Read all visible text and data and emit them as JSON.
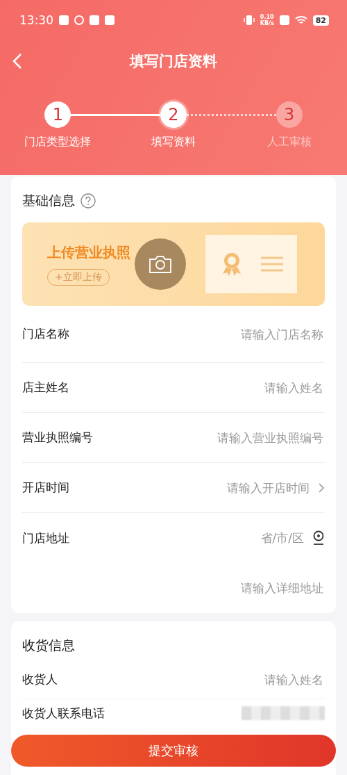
{
  "status_bar": {
    "time": "13:30",
    "speed_value": "0.10",
    "speed_unit": "KB/s",
    "battery": "82"
  },
  "header": {
    "title": "填写门店资料"
  },
  "steps": [
    {
      "number": "1",
      "label": "门店类型选择",
      "done": true,
      "selected": false
    },
    {
      "number": "2",
      "label": "填写资料",
      "done": false,
      "selected": true
    },
    {
      "number": "3",
      "label": "人工审核",
      "done": false,
      "selected": false
    }
  ],
  "basic_section": {
    "title": "基础信息",
    "upload": {
      "title": "上传营业执照",
      "button": "+立即上传"
    },
    "fields": [
      {
        "label": "门店名称",
        "placeholder": "请输入门店名称",
        "kind": "text"
      },
      {
        "label": "店主姓名",
        "placeholder": "请输入姓名",
        "kind": "text"
      },
      {
        "label": "营业执照编号",
        "placeholder": "请输入营业执照编号",
        "kind": "text"
      },
      {
        "label": "开店时间",
        "placeholder": "请输入开店时间",
        "kind": "picker"
      },
      {
        "label": "门店地址",
        "placeholder": "省/市/区",
        "kind": "location"
      },
      {
        "placeholder": "请输入详细地址",
        "kind": "text"
      }
    ]
  },
  "delivery_section": {
    "title": "收货信息",
    "fields": [
      {
        "label": "收货人",
        "placeholder": "请输入姓名",
        "kind": "text"
      },
      {
        "label": "收货人联系电话",
        "kind": "redacted"
      }
    ]
  },
  "submit_button": "提交审核"
}
